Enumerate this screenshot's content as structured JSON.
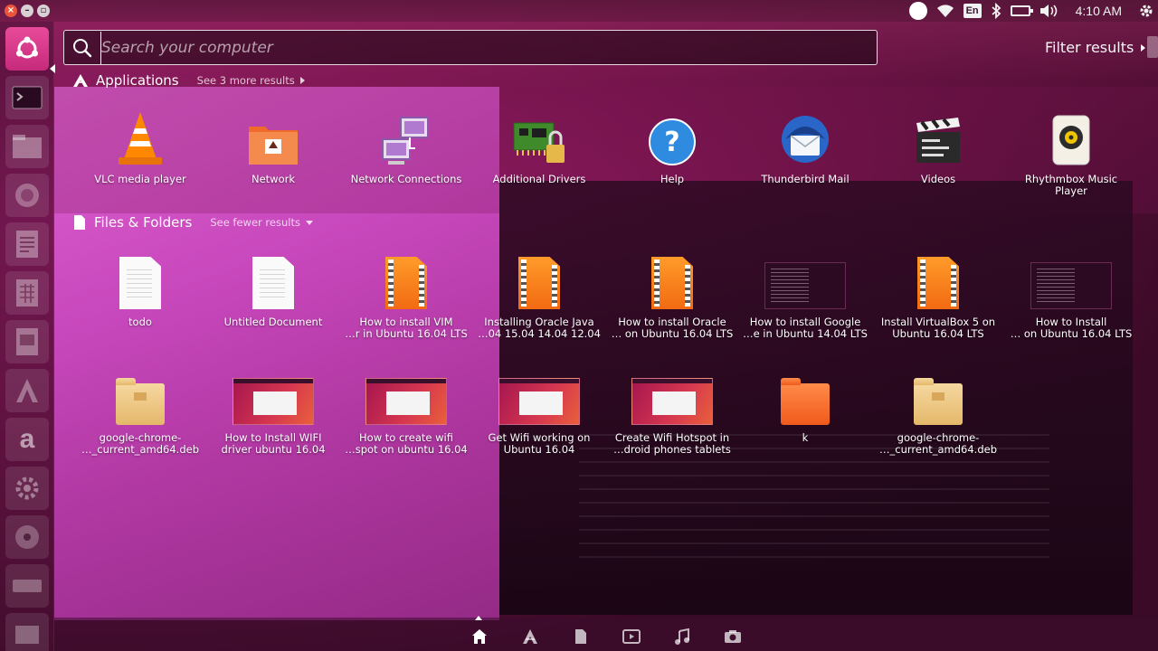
{
  "top_panel": {
    "keyboard_layout": "En",
    "time": "4:10 AM"
  },
  "search": {
    "placeholder": "Search your computer",
    "value": ""
  },
  "filter_results_label": "Filter results",
  "applications": {
    "title": "Applications",
    "more_link": "See 3 more results",
    "items": [
      {
        "label": "VLC media player",
        "icon": "vlc-icon"
      },
      {
        "label": "Network",
        "icon": "network-folder-icon"
      },
      {
        "label": "Network Connections",
        "icon": "network-connections-icon"
      },
      {
        "label": "Additional Drivers",
        "icon": "additional-drivers-icon"
      },
      {
        "label": "Help",
        "icon": "help-icon"
      },
      {
        "label": "Thunderbird Mail",
        "icon": "thunderbird-icon"
      },
      {
        "label": "Videos",
        "icon": "videos-icon"
      },
      {
        "label": "Rhythmbox Music\nPlayer",
        "icon": "rhythmbox-icon"
      }
    ]
  },
  "files": {
    "title": "Files & Folders",
    "fewer_link": "See fewer results",
    "items": [
      {
        "label": "todo",
        "icon": "text-document-icon"
      },
      {
        "label": "Untitled Document",
        "icon": "text-document-icon"
      },
      {
        "label": "How to install VIM\n…r in Ubuntu 16.04 LTS",
        "icon": "video-file-icon"
      },
      {
        "label": "Installing Oracle Java\n…04 15.04 14.04 12.04",
        "icon": "video-file-icon"
      },
      {
        "label": "How to install Oracle\n… on Ubuntu 16.04 LTS",
        "icon": "video-file-icon"
      },
      {
        "label": "How to install Google\n…e in Ubuntu 14.04 LTS",
        "icon": "terminal-screenshot-icon"
      },
      {
        "label": "Install VirtualBox 5 on\nUbuntu 16.04 LTS",
        "icon": "video-file-icon"
      },
      {
        "label": "How to Install\n… on Ubuntu 16.04 LTS",
        "icon": "terminal-screenshot-icon"
      },
      {
        "label": "google-chrome-\n…_current_amd64.deb",
        "icon": "package-icon"
      },
      {
        "label": "How to Install WIFI\ndriver ubuntu 16.04",
        "icon": "ubuntu-screenshot-icon"
      },
      {
        "label": "How to create wifi\n…spot on ubuntu 16.04",
        "icon": "ubuntu-screenshot-icon"
      },
      {
        "label": "Get Wifi working on\nUbuntu 16.04",
        "icon": "ubuntu-screenshot-icon"
      },
      {
        "label": "Create Wifi Hotspot in\n…droid phones tablets",
        "icon": "ubuntu-screenshot-icon"
      },
      {
        "label": "k",
        "icon": "folder-icon"
      },
      {
        "label": "google-chrome-\n…_current_amd64.deb",
        "icon": "package-icon"
      }
    ]
  },
  "colors": {
    "accent": "#e84b9a",
    "panel": "#3c0f28"
  }
}
